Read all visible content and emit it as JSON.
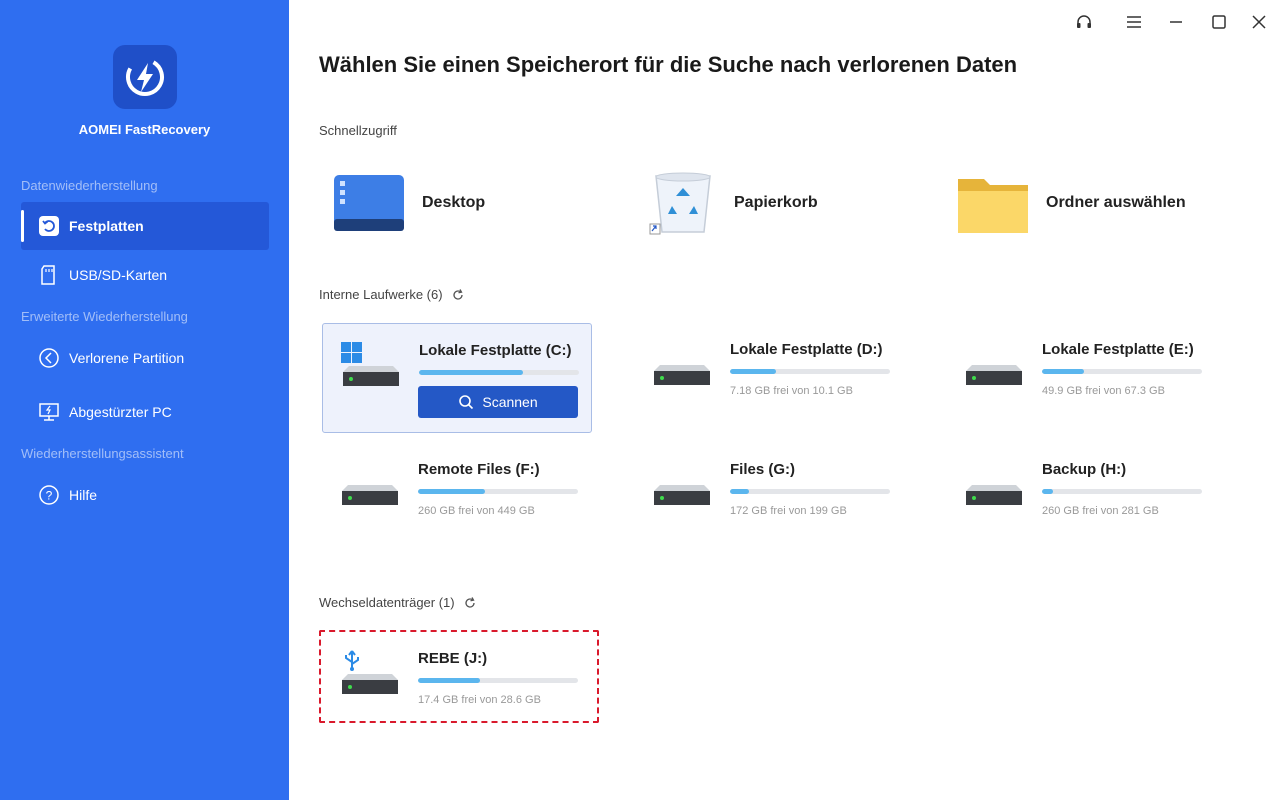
{
  "app": {
    "name": "AOMEI FastRecovery"
  },
  "sidebar": {
    "sections": [
      {
        "label": "Datenwiederherstellung"
      },
      {
        "label": "Erweiterte Wiederherstellung"
      },
      {
        "label": "Wiederherstellungsassistent"
      }
    ],
    "items": [
      {
        "label": "Festplatten",
        "icon": "restore-icon",
        "active": true
      },
      {
        "label": "USB/SD-Karten",
        "icon": "sd-card-icon"
      },
      {
        "label": "Verlorene Partition",
        "icon": "partition-icon"
      },
      {
        "label": "Abgestürzter PC",
        "icon": "monitor-icon"
      },
      {
        "label": "Hilfe",
        "icon": "help-icon"
      }
    ]
  },
  "main": {
    "title": "Wählen Sie einen Speicherort für die Suche nach verlorenen Daten",
    "quick_access": {
      "label": "Schnellzugriff",
      "items": [
        {
          "label": "Desktop",
          "icon": "desktop-icon"
        },
        {
          "label": "Papierkorb",
          "icon": "recycle-bin-icon"
        },
        {
          "label": "Ordner auswählen",
          "icon": "folder-icon"
        }
      ]
    },
    "internal": {
      "label": "Interne Laufwerke (6)",
      "drives": [
        {
          "name": "Lokale Festplatte (C:)",
          "free": "",
          "used_fraction": 0.65,
          "selected": true,
          "scan_label": "Scannen"
        },
        {
          "name": "Lokale Festplatte (D:)",
          "free": "7.18 GB frei von 10.1 GB",
          "used_fraction": 0.29
        },
        {
          "name": "Lokale Festplatte (E:)",
          "free": "49.9 GB frei von 67.3 GB",
          "used_fraction": 0.26
        },
        {
          "name": "Remote Files (F:)",
          "free": "260 GB frei von 449 GB",
          "used_fraction": 0.42
        },
        {
          "name": "Files (G:)",
          "free": "172 GB frei von 199 GB",
          "used_fraction": 0.12
        },
        {
          "name": "Backup (H:)",
          "free": "260 GB frei von 281 GB",
          "used_fraction": 0.07
        }
      ]
    },
    "removable": {
      "label": "Wechseldatenträger (1)",
      "drives": [
        {
          "name": "REBE (J:)",
          "free": "17.4 GB frei von 28.6 GB",
          "used_fraction": 0.39
        }
      ]
    }
  },
  "colors": {
    "sidebar": "#2f6ef0",
    "accent": "#2458c6",
    "bar_fill": "#5bb6ee",
    "highlight_border": "#d9192c"
  }
}
